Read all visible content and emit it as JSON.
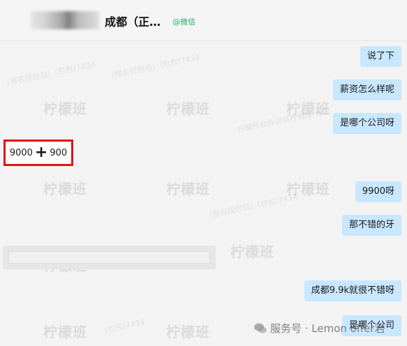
{
  "header": {
    "title": "成都（正…",
    "tag": "@微信"
  },
  "watermarks": {
    "brand": "柠檬班",
    "sub_lines": [
      "柠檬班软件测试柠檬班·包包",
      "(报名找包包)（包包)7434",
      "(包包)7434"
    ]
  },
  "messages": {
    "m1": "说了下",
    "m2": "薪资怎么样呢",
    "m3": "是哪个公司呀",
    "reply_left_a": "9000",
    "reply_left_plus": "+",
    "reply_left_b": "900",
    "m4": "9900呀",
    "m5": "那不错的牙",
    "m6": "成都9.9k就很不错呀",
    "m7": "是哪个公司"
  },
  "footer": {
    "text": "服务号 · Lemon offer君"
  },
  "colors": {
    "self_bubble": "#c9e7ff",
    "other_bubble": "#ffffff",
    "highlight_box": "#e31212",
    "tag_green": "#2aae67"
  }
}
